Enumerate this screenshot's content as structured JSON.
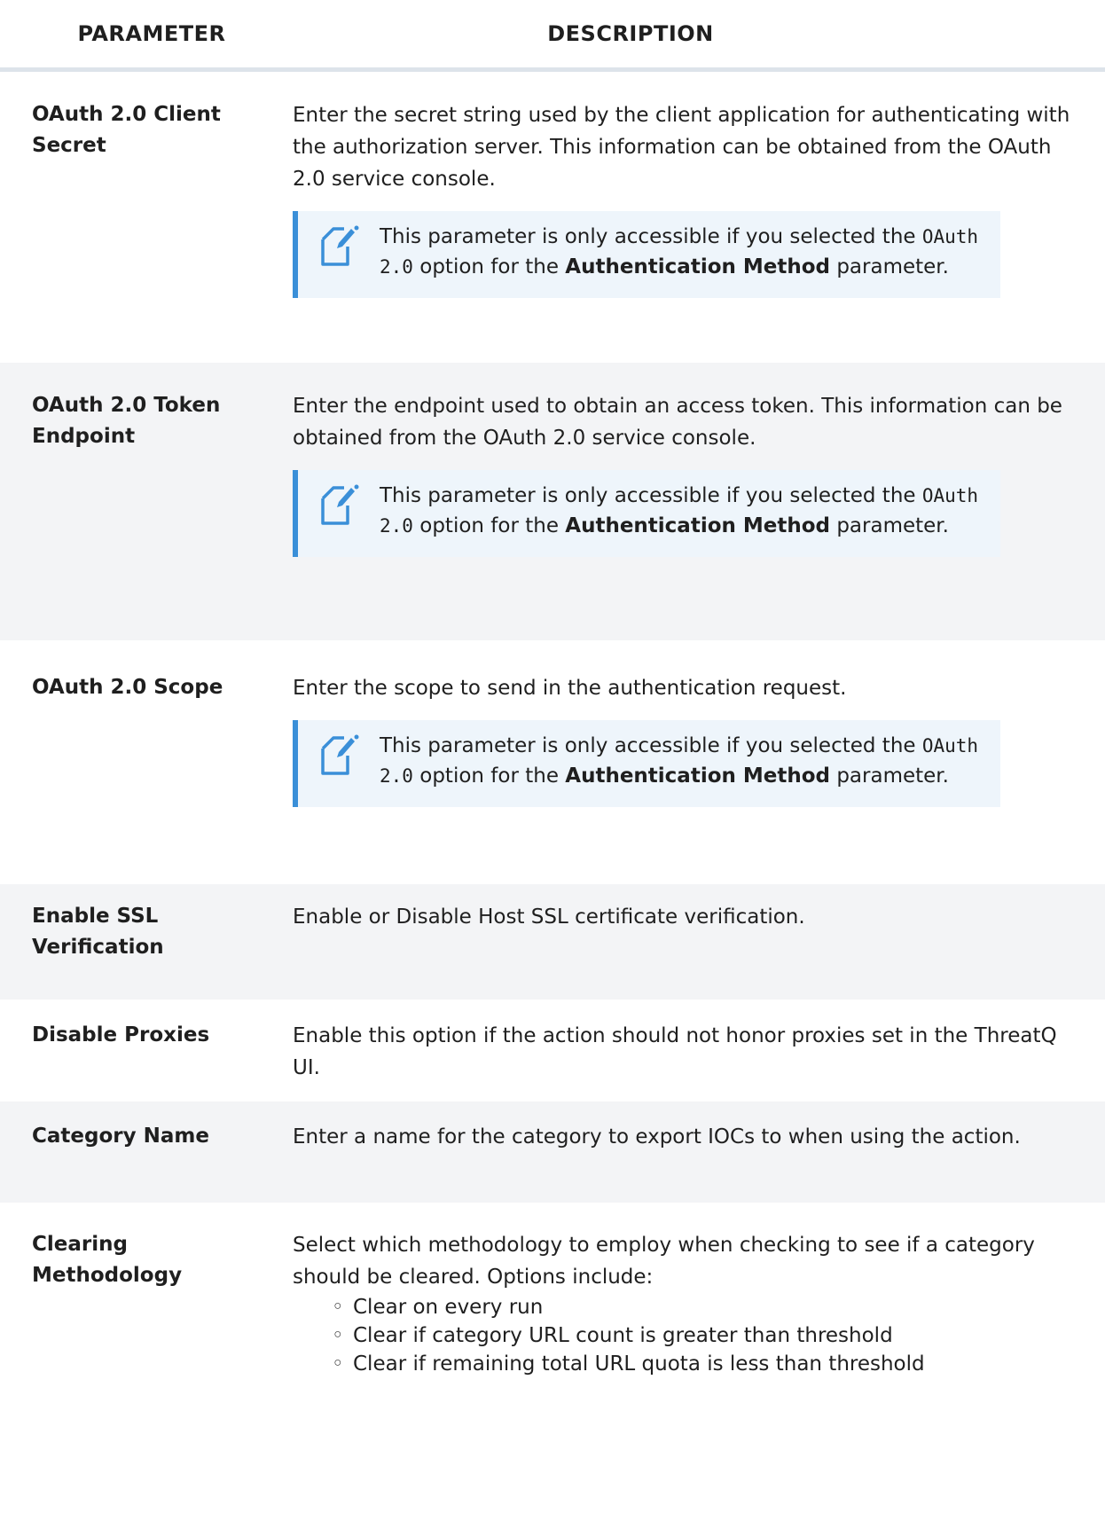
{
  "header": {
    "parameter": "PARAMETER",
    "description": "DESCRIPTION"
  },
  "note": {
    "text_before": "This parameter is only accessible if you selected the ",
    "code": "OAuth 2.0",
    "text_middle": " option for the ",
    "bold": "Authentication Method",
    "text_after": " parameter.",
    "icon": "note-icon"
  },
  "rows": [
    {
      "name": "OAuth 2.0 Client Secret",
      "description": "Enter the secret string used by the client application for authenticating with the authorization server. This information can be obtained from the OAuth 2.0 service console."
    },
    {
      "name": "OAuth 2.0 Token Endpoint",
      "description": "Enter the endpoint used to obtain an access token. This information can be obtained from the OAuth 2.0 service console."
    },
    {
      "name": "OAuth 2.0 Scope",
      "description": "Enter the scope to send in the authentication request."
    },
    {
      "name": "Enable SSL Verification",
      "description": "Enable or Disable Host SSL certificate verification."
    },
    {
      "name": "Disable Proxies",
      "description": "Enable this option if the action should not honor proxies set in the ThreatQ UI."
    },
    {
      "name": "Category Name",
      "description": "Enter a name for the category to export IOCs to when using the action."
    },
    {
      "name": "Clearing Methodology",
      "description": "Select which methodology to employ when checking to see if a category should be cleared. Options include:",
      "options": [
        "Clear on every run",
        "Clear if category URL count is greater than threshold",
        "Clear if remaining total URL quota is less than threshold"
      ]
    }
  ],
  "colors": {
    "accent": "#3a8fd8",
    "note_bg": "#eef5fb",
    "row_alt": "#f3f4f6",
    "header_rule": "#dde3ea"
  }
}
